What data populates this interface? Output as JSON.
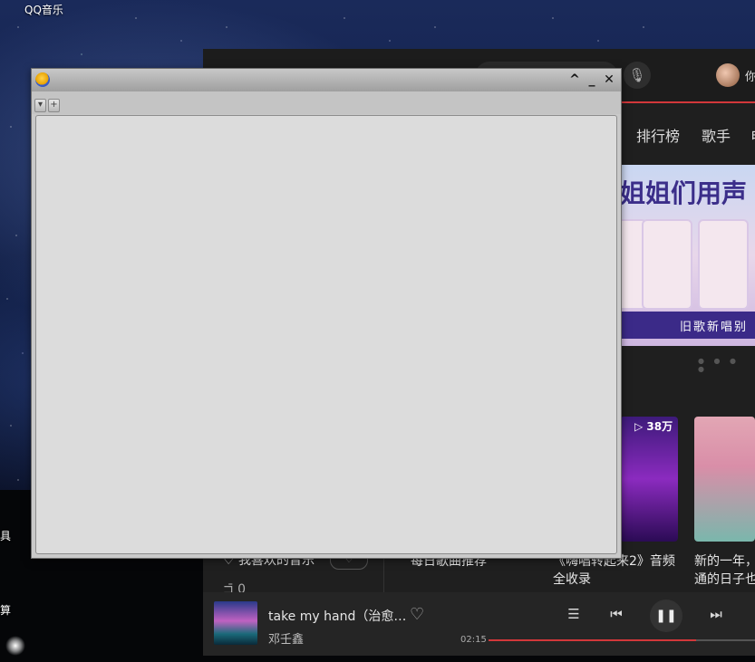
{
  "desktop": {
    "app_label": "QQ音乐",
    "side_fragment_1": "具",
    "side_fragment_2": "算"
  },
  "music_app": {
    "user_name": "你",
    "nav": [
      "排行榜",
      "歌手",
      "电"
    ],
    "banner": {
      "title": "姐姐们用声",
      "subtitle": "旧歌新唱别"
    },
    "card_playcount": "▷ 38万",
    "rows": {
      "left_row_1": "♡ 我喜欢的音乐",
      "left_row_2": "⊐̄ 0",
      "mid_label": "每日歌曲推荐",
      "card_mid_title_1": "《嗨唱转起来2》音频",
      "card_mid_title_2": "全收录",
      "card_right_title_1": "新的一年，",
      "card_right_title_2": "通的日子也"
    },
    "player": {
      "song_title": "take my hand（治愈…",
      "artist": "邓壬鑫",
      "elapsed": "02:15",
      "progress_fraction": 0.78
    }
  },
  "dialog": {
    "controls": [
      "^",
      "_",
      "✕"
    ],
    "toolbar_buttons": [
      "▾",
      "+"
    ]
  },
  "colors": {
    "accent_red": "#d2373a",
    "dialog_body": "#dcdcdc"
  }
}
